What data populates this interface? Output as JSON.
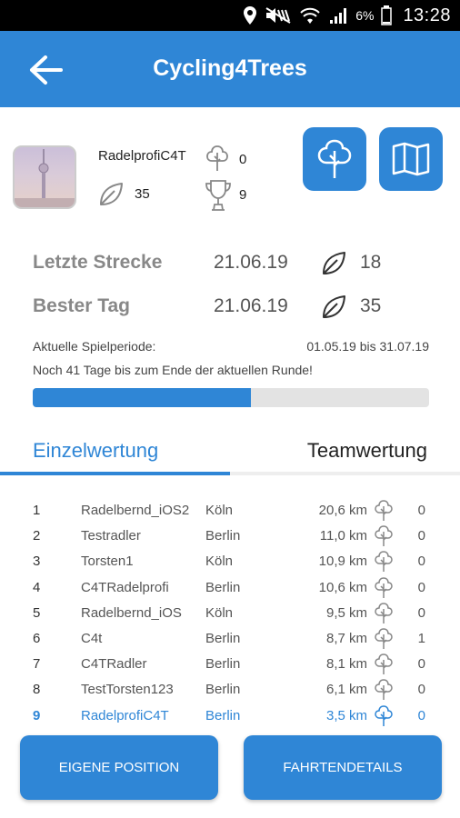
{
  "status_bar": {
    "battery_percent": "6%",
    "time": "13:28"
  },
  "app_bar": {
    "title": "Cycling4Trees"
  },
  "profile": {
    "username": "RadelprofiC4T",
    "leaf_count": "35",
    "tree_count": "0",
    "trophy_count": "9"
  },
  "stats": {
    "last_route_label": "Letzte Strecke",
    "last_route_date": "21.06.19",
    "last_route_value": "18",
    "best_day_label": "Bester Tag",
    "best_day_date": "21.06.19",
    "best_day_value": "35"
  },
  "period": {
    "label": "Aktuelle Spielperiode:",
    "range": "01.05.19 bis 31.07.19",
    "remaining_text": "Noch 41 Tage bis zum Ende der aktuellen Runde!",
    "progress_percent": 55
  },
  "tabs": {
    "single": "Einzelwertung",
    "team": "Teamwertung",
    "active": "single"
  },
  "ranking": [
    {
      "rank": "1",
      "name": "Radelbernd_iOS2",
      "city": "Köln",
      "km": "20,6 km",
      "trees": "0"
    },
    {
      "rank": "2",
      "name": "Testradler",
      "city": "Berlin",
      "km": "11,0 km",
      "trees": "0"
    },
    {
      "rank": "3",
      "name": "Torsten1",
      "city": "Köln",
      "km": "10,9 km",
      "trees": "0"
    },
    {
      "rank": "4",
      "name": "C4TRadelprofi",
      "city": "Berlin",
      "km": "10,6 km",
      "trees": "0"
    },
    {
      "rank": "5",
      "name": "Radelbernd_iOS",
      "city": "Köln",
      "km": "9,5 km",
      "trees": "0"
    },
    {
      "rank": "6",
      "name": "C4t",
      "city": "Berlin",
      "km": "8,7 km",
      "trees": "1"
    },
    {
      "rank": "7",
      "name": "C4TRadler",
      "city": "Berlin",
      "km": "8,1 km",
      "trees": "0"
    },
    {
      "rank": "8",
      "name": "TestTorsten123",
      "city": "Berlin",
      "km": "6,1 km",
      "trees": "0"
    },
    {
      "rank": "9",
      "name": "RadelprofiC4T",
      "city": "Berlin",
      "km": "3,5 km",
      "trees": "0",
      "highlight": true
    }
  ],
  "buttons": {
    "own_position": "EIGENE POSITION",
    "ride_details": "FAHRTENDETAILS"
  },
  "colors": {
    "primary": "#2f86d6",
    "muted_label": "#888888",
    "track": "#e3e3e3"
  }
}
